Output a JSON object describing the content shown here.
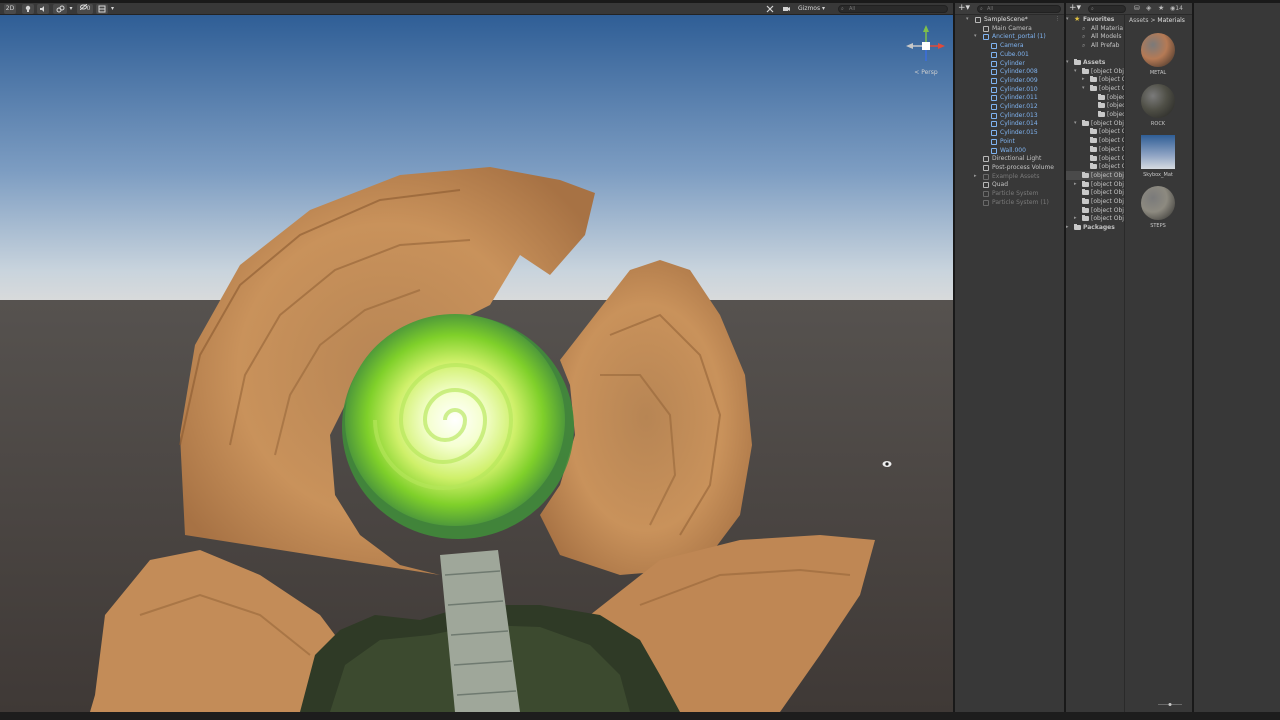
{
  "colors": {
    "editor_bg": "#383838",
    "toolbar_bg": "#383838",
    "selection": "#4a4a4a",
    "prefab_blue": "#7fb3f0",
    "portal_green": "#7fd02a",
    "stone": "#c9925b"
  },
  "scene_toolbar": {
    "mode_2d": "2D",
    "effects_count": "0",
    "gizmos_label": "Gizmos",
    "search_placeholder": "All"
  },
  "gizmo": {
    "projection": "< Persp"
  },
  "hierarchy": {
    "search_placeholder": "All",
    "items": [
      {
        "label": "SampleScene*",
        "style": "scene"
      },
      {
        "label": "Main Camera",
        "style": "normal"
      },
      {
        "label": "Ancient_portal (1)",
        "style": "prefab"
      },
      {
        "label": "Camera",
        "style": "prefab"
      },
      {
        "label": "Cube.001",
        "style": "prefab"
      },
      {
        "label": "Cylinder",
        "style": "prefab"
      },
      {
        "label": "Cylinder.008",
        "style": "prefab"
      },
      {
        "label": "Cylinder.009",
        "style": "prefab"
      },
      {
        "label": "Cylinder.010",
        "style": "prefab"
      },
      {
        "label": "Cylinder.011",
        "style": "prefab"
      },
      {
        "label": "Cylinder.012",
        "style": "prefab"
      },
      {
        "label": "Cylinder.013",
        "style": "prefab"
      },
      {
        "label": "Cylinder.014",
        "style": "prefab"
      },
      {
        "label": "Cylinder.015",
        "style": "prefab"
      },
      {
        "label": "Point",
        "style": "prefab"
      },
      {
        "label": "Wall.000",
        "style": "prefab"
      },
      {
        "label": "Directional Light",
        "style": "normal"
      },
      {
        "label": "Post-process Volume",
        "style": "normal"
      },
      {
        "label": "Example Assets",
        "style": "disabled"
      },
      {
        "label": "Quad",
        "style": "normal"
      },
      {
        "label": "Particle System",
        "style": "disabled"
      },
      {
        "label": "Particle System (1)",
        "style": "disabled"
      }
    ]
  },
  "project": {
    "search_placeholder": "",
    "hidden_count": "14",
    "favorites_label": "Favorites",
    "favorites": [
      "All Materia",
      "All Models",
      "All Prefab"
    ],
    "assets_label": "Assets",
    "tree": [
      {
        "label": "Ancient_po"
      },
      {
        "label": "_MACO"
      },
      {
        "label": "Ancient"
      },
      {
        "label": "Groun"
      },
      {
        "label": "Metal"
      },
      {
        "label": "RockC"
      },
      {
        "label": "ExampleAs"
      },
      {
        "label": "Material"
      },
      {
        "label": "Models"
      },
      {
        "label": "Prefabs"
      },
      {
        "label": "Shaders"
      },
      {
        "label": "Textures"
      },
      {
        "label": "Materials"
      },
      {
        "label": "Presets"
      },
      {
        "label": "Scenes"
      },
      {
        "label": "Scripts"
      },
      {
        "label": "Settings"
      },
      {
        "label": "TutorialInfo"
      }
    ],
    "packages_label": "Packages",
    "breadcrumb": {
      "root": "Assets",
      "sep": ">",
      "current": "Materials"
    },
    "materials": [
      {
        "name": "METAL",
        "color": "#b57a55"
      },
      {
        "name": "ROCK",
        "color": "#4f4f46"
      },
      {
        "name": "Skybox_Mat",
        "color": "#8fa4c4"
      },
      {
        "name": "STEPS",
        "color": "#8d8a80"
      }
    ]
  }
}
